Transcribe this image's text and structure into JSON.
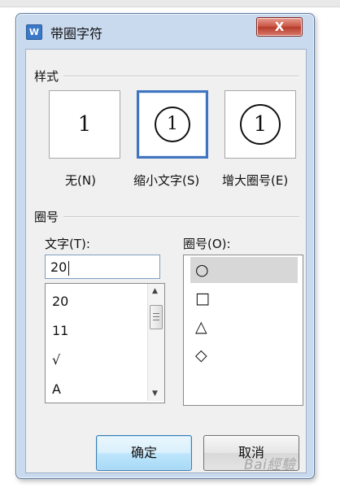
{
  "window": {
    "title": "带圈字符",
    "app_icon": "W",
    "close_label": "X"
  },
  "style_section": {
    "label": "样式",
    "options": [
      {
        "preview": "1",
        "caption": "无(N)"
      },
      {
        "preview": "1",
        "caption": "缩小文字(S)"
      },
      {
        "preview": "1",
        "caption": "增大圈号(E)"
      }
    ],
    "selected_index": 1
  },
  "enclosure_section": {
    "label": "圈号",
    "text_label": "文字(T):",
    "text_value": "20",
    "text_list": [
      "20",
      "11",
      "√",
      "A"
    ],
    "enclosure_label": "圈号(O):",
    "enclosures": [
      "○",
      "□",
      "△",
      "◇"
    ],
    "selected_enclosure": 0
  },
  "buttons": {
    "ok": "确定",
    "cancel": "取消"
  },
  "watermark": "Bai經驗"
}
